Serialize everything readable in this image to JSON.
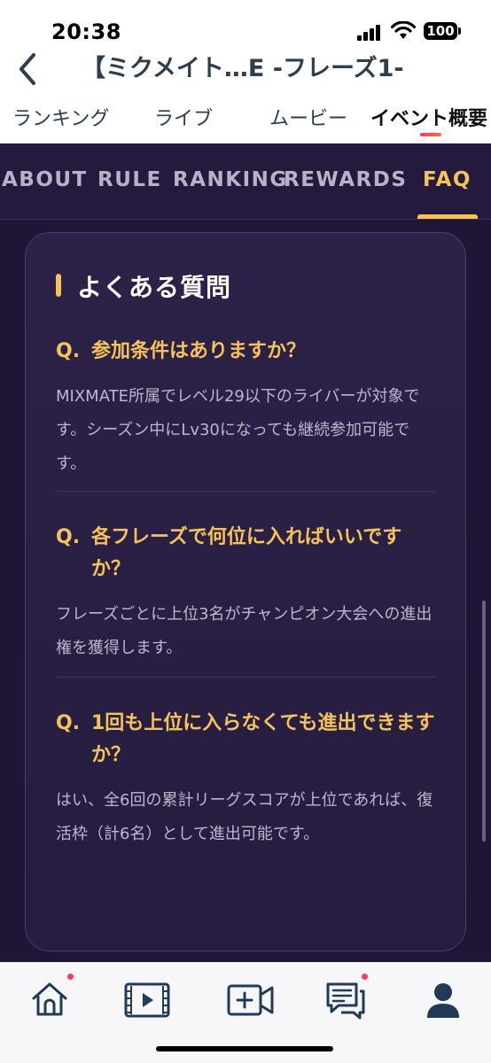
{
  "status_bar": {
    "time": "20:38",
    "battery": "100"
  },
  "header": {
    "title": "【ミクメイト…E -フレーズ1-"
  },
  "top_tabs": [
    {
      "label": "ランキング"
    },
    {
      "label": "ライブ"
    },
    {
      "label": "ムービー"
    },
    {
      "label": "イベント概要",
      "active": true
    }
  ],
  "event_tabs": [
    {
      "label": "ABOUT"
    },
    {
      "label": "RULE"
    },
    {
      "label": "RANKING"
    },
    {
      "label": "REWARDS"
    },
    {
      "label": "FAQ",
      "active": true
    }
  ],
  "faq_section": {
    "title": "よくある質問",
    "items": [
      {
        "q_prefix": "Q.",
        "question": "参加条件はありますか？",
        "answer": "MIXMATE所属でレベル29以下のライバーが対象です。シーズン中にLv30になっても継続参加可能です。"
      },
      {
        "q_prefix": "Q.",
        "question": "各フレーズで何位に入ればいいですか？",
        "answer": "フレーズごとに上位3名がチャンピオン大会への進出権を獲得します。"
      },
      {
        "q_prefix": "Q.",
        "question": "1回も上位に入らなくても進出できますか？",
        "answer": "はい、全6回の累計リーグスコアが上位であれば、復活枠（計6名）として進出可能です。"
      }
    ]
  },
  "bottom_nav": [
    {
      "icon": "home-icon",
      "badge": true
    },
    {
      "icon": "video-icon",
      "badge": false
    },
    {
      "icon": "camera-plus-icon",
      "badge": false
    },
    {
      "icon": "chat-icon",
      "badge": true
    },
    {
      "icon": "profile-icon",
      "badge": false
    }
  ],
  "colors": {
    "accent": "#f5c35a",
    "background": "#1f1536",
    "badge": "#ff3b5c"
  }
}
